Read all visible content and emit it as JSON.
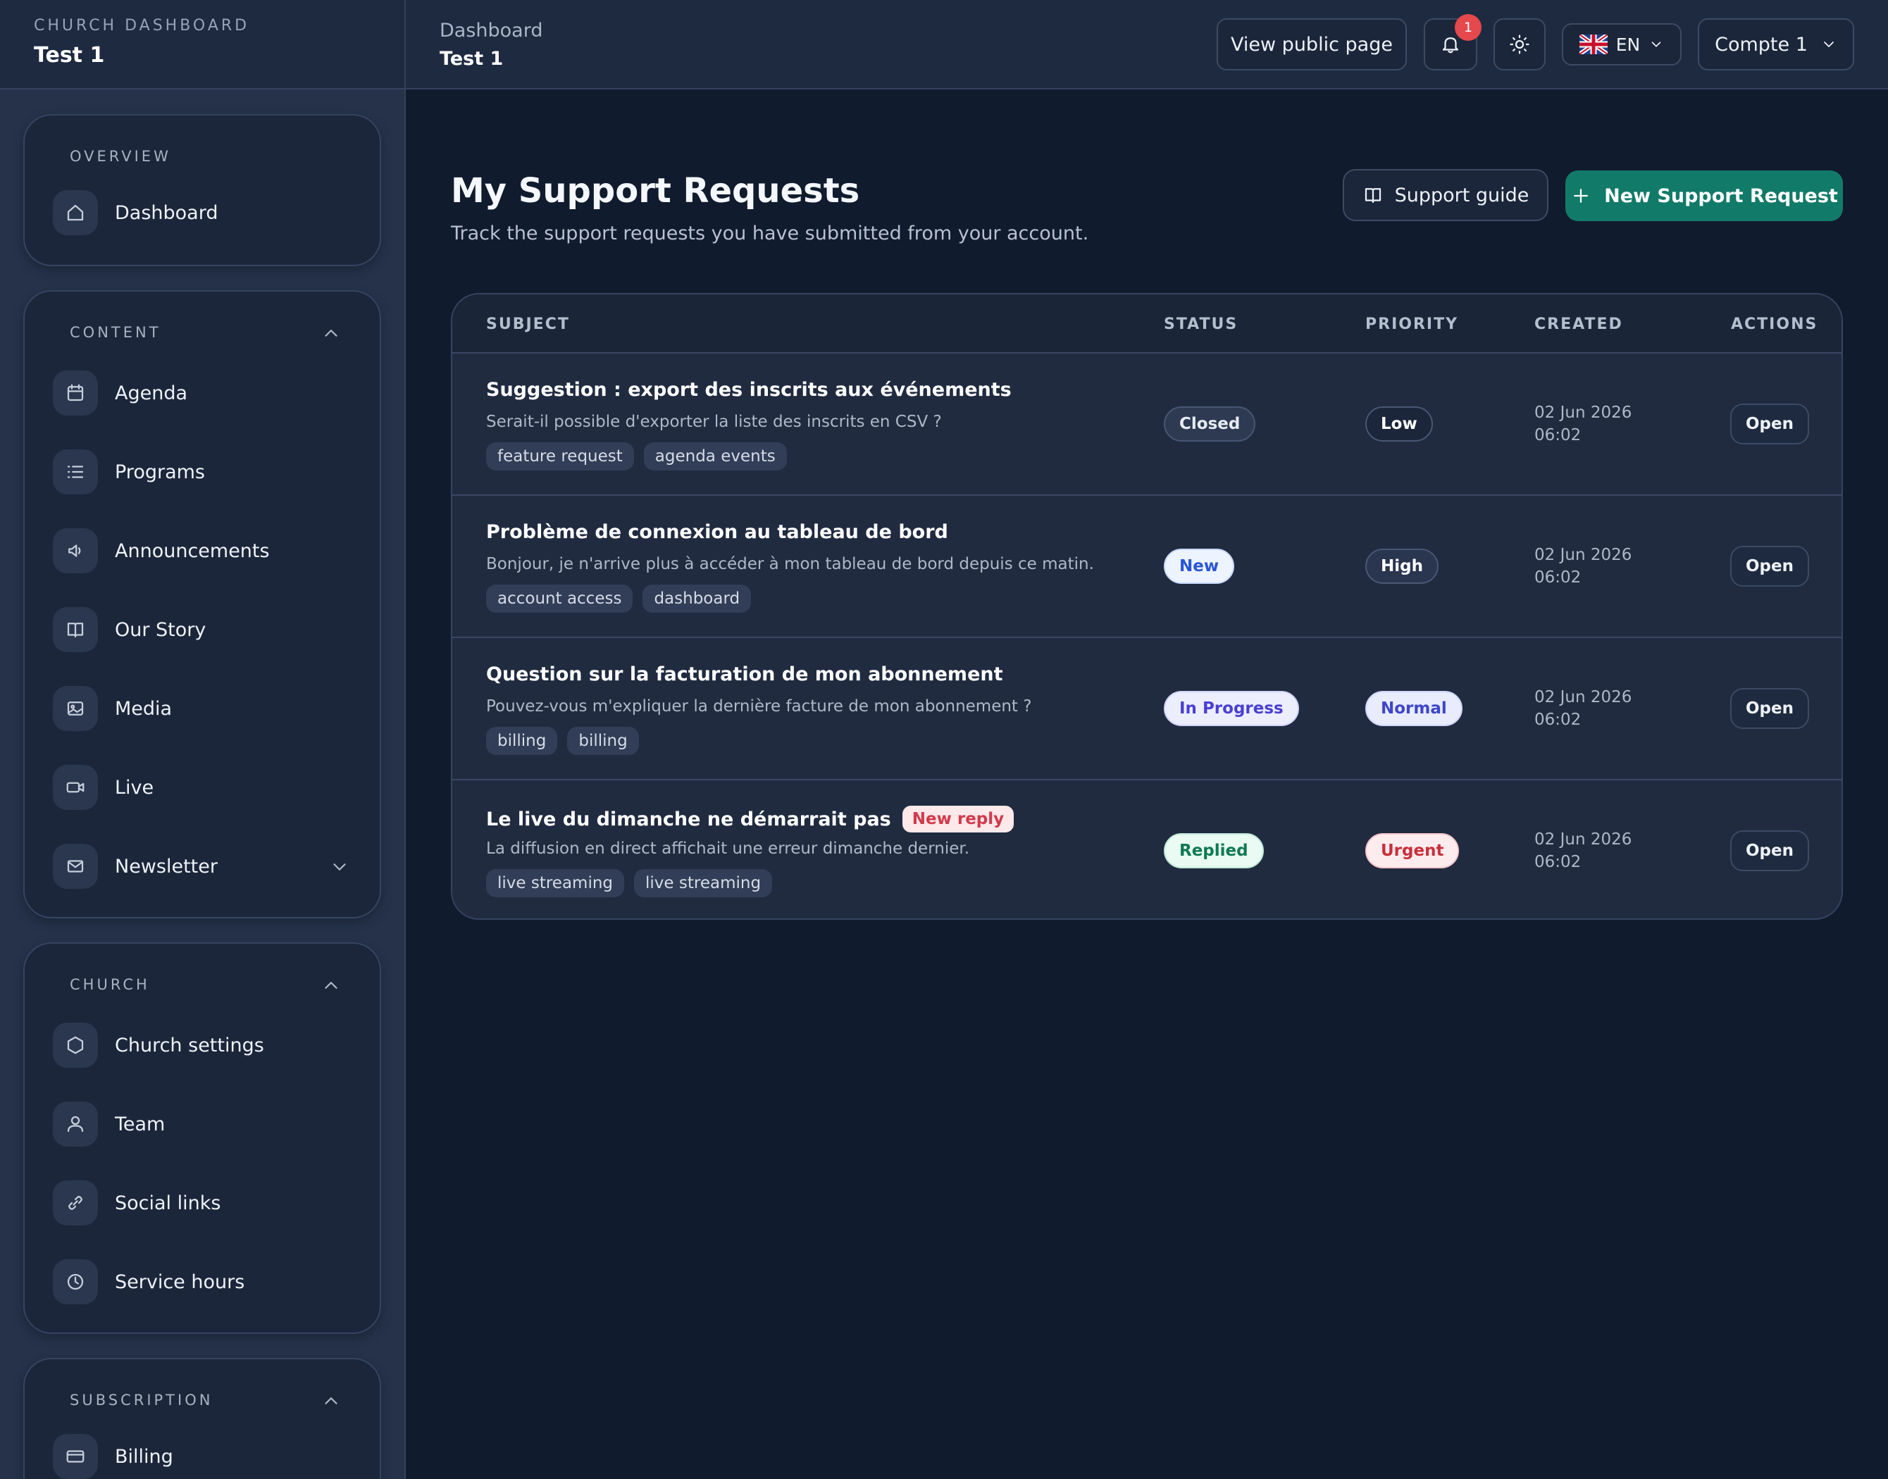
{
  "brand": {
    "label": "CHURCH DASHBOARD",
    "name": "Test 1"
  },
  "header": {
    "crumb": "Dashboard",
    "crumb_sub": "Test 1",
    "view_public": "View public page",
    "notif_count": "1",
    "lang": "EN",
    "account": "Compte 1"
  },
  "sidebar": {
    "overview": {
      "title": "OVERVIEW",
      "items": [
        {
          "label": "Dashboard",
          "icon": "home-icon"
        }
      ]
    },
    "content": {
      "title": "CONTENT",
      "items": [
        {
          "label": "Agenda",
          "icon": "calendar-icon"
        },
        {
          "label": "Programs",
          "icon": "list-icon"
        },
        {
          "label": "Announcements",
          "icon": "megaphone-icon"
        },
        {
          "label": "Our Story",
          "icon": "book-icon"
        },
        {
          "label": "Media",
          "icon": "image-icon"
        },
        {
          "label": "Live",
          "icon": "video-icon"
        },
        {
          "label": "Newsletter",
          "icon": "mail-icon"
        }
      ]
    },
    "church": {
      "title": "CHURCH",
      "items": [
        {
          "label": "Church settings",
          "icon": "hexagon-icon"
        },
        {
          "label": "Team",
          "icon": "user-icon"
        },
        {
          "label": "Social links",
          "icon": "link-icon"
        },
        {
          "label": "Service hours",
          "icon": "clock-icon"
        }
      ]
    },
    "subscription": {
      "title": "SUBSCRIPTION",
      "items": [
        {
          "label": "Billing",
          "icon": "card-icon"
        }
      ]
    }
  },
  "main": {
    "title": "My Support Requests",
    "subtitle": "Track the support requests you have submitted from your account.",
    "guide_label": "Support guide",
    "new_label": "New Support Request",
    "columns": {
      "subject": "SUBJECT",
      "status": "STATUS",
      "priority": "PRIORITY",
      "created": "CREATED",
      "actions": "ACTIONS"
    },
    "open_label": "Open",
    "rows": [
      {
        "subject": "Suggestion : export des inscrits aux événements",
        "reply": "",
        "desc": "Serait-il possible d'exporter la liste des inscrits en CSV ?",
        "tags": [
          "feature request",
          "agenda events"
        ],
        "status": "Closed",
        "priority": "Low",
        "date": "02 Jun 2026",
        "time": "06:02"
      },
      {
        "subject": "Problème de connexion au tableau de bord",
        "reply": "",
        "desc": "Bonjour, je n'arrive plus à accéder à mon tableau de bord depuis ce matin.",
        "tags": [
          "account access",
          "dashboard"
        ],
        "status": "New",
        "priority": "High",
        "date": "02 Jun 2026",
        "time": "06:02"
      },
      {
        "subject": "Question sur la facturation de mon abonnement",
        "reply": "",
        "desc": "Pouvez-vous m'expliquer la dernière facture de mon abonnement ?",
        "tags": [
          "billing",
          "billing"
        ],
        "status": "In Progress",
        "priority": "Normal",
        "date": "02 Jun 2026",
        "time": "06:02"
      },
      {
        "subject": "Le live du dimanche ne démarrait pas",
        "reply": "New reply",
        "desc": "La diffusion en direct affichait une erreur dimanche dernier.",
        "tags": [
          "live streaming",
          "live streaming"
        ],
        "status": "Replied",
        "priority": "Urgent",
        "date": "02 Jun 2026",
        "time": "06:02"
      }
    ]
  },
  "colors": {
    "accent": "#127a68",
    "status_closed_bg": "#2e3a52",
    "status_closed_fg": "#e6ebf2",
    "status_new_bg": "#eef4ff",
    "status_new_fg": "#2a55d6",
    "status_progress_bg": "#eceefe",
    "status_progress_fg": "#4a3fd1",
    "status_replied_bg": "#e9fbf3",
    "status_replied_fg": "#0f7a55",
    "priority_low_bg": "#1b263a",
    "priority_low_fg": "#ffffff",
    "priority_high_bg": "#2a3550",
    "priority_high_fg": "#ffffff",
    "priority_normal_bg": "#e8ecfd",
    "priority_normal_fg": "#3f46c9",
    "priority_urgent_bg": "#fdecee",
    "priority_urgent_fg": "#c9303b"
  }
}
